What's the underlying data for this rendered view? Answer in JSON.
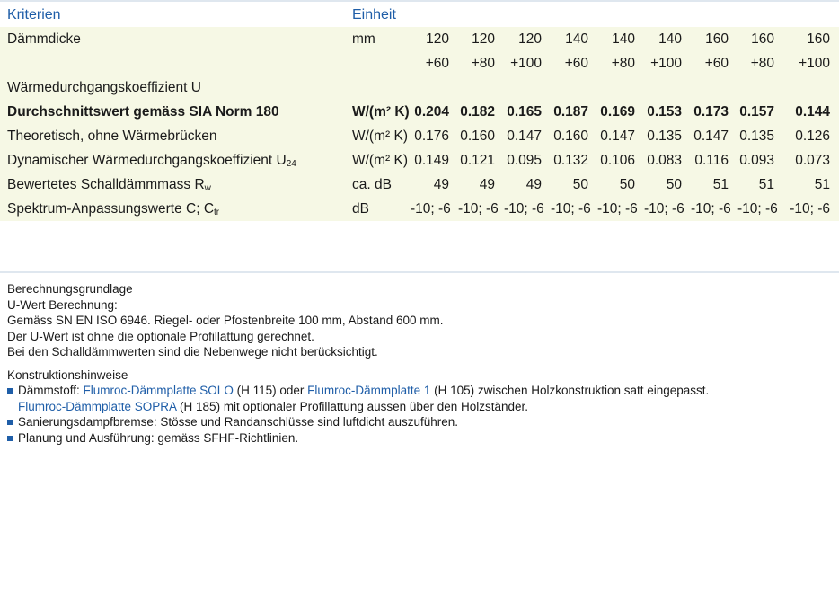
{
  "header": {
    "criteria": "Kriterien",
    "unit": "Einheit"
  },
  "rows": {
    "thickness": {
      "label": "Dämmdicke",
      "unit": "mm",
      "line1": [
        "120",
        "120",
        "120",
        "140",
        "140",
        "140",
        "160",
        "160",
        "160"
      ],
      "line2": [
        "+60",
        "+80",
        "+100",
        "+60",
        "+80",
        "+100",
        "+60",
        "+80",
        "+100"
      ]
    },
    "u_heading": "Wärmedurchgangskoeffizient U",
    "avg": {
      "label": "Durchschnittswert gemäss SIA Norm 180",
      "unit": "W/(m² K)",
      "values": [
        "0.204",
        "0.182",
        "0.165",
        "0.187",
        "0.169",
        "0.153",
        "0.173",
        "0.157",
        "0.144"
      ]
    },
    "theo": {
      "label": "Theoretisch, ohne Wärmebrücken",
      "unit": "W/(m² K)",
      "values": [
        "0.176",
        "0.160",
        "0.147",
        "0.160",
        "0.147",
        "0.135",
        "0.147",
        "0.135",
        "0.126"
      ]
    },
    "dyn": {
      "label": "Dynamischer Wärmedurchgangskoeffizient U",
      "sub": "24",
      "unit": "W/(m² K)",
      "values": [
        "0.149",
        "0.121",
        "0.095",
        "0.132",
        "0.106",
        "0.083",
        "0.116",
        "0.093",
        "0.073"
      ]
    },
    "sound": {
      "label": "Bewertetes Schalldämmmass R",
      "sub": "w",
      "unit": "ca. dB",
      "values": [
        "49",
        "49",
        "49",
        "50",
        "50",
        "50",
        "51",
        "51",
        "51"
      ]
    },
    "spectrum": {
      "label": "Spektrum-Anpassungswerte C; C",
      "sub": "tr",
      "unit": "dB",
      "values": [
        "-10; -6",
        "-10; -6",
        "-10; -6",
        "-10; -6",
        "-10; -6",
        "-10; -6",
        "-10; -6",
        "-10; -6",
        "-10; -6"
      ]
    }
  },
  "notes": {
    "calc_title": "Berechnungsgrundlage",
    "calc_lines": [
      "U-Wert Berechnung:",
      "Gemäss SN EN ISO 6946. Riegel- oder Pfostenbreite 100 mm, Abstand 600 mm.",
      "Der U-Wert ist ohne die optionale Profillattung gerechnet.",
      "Bei den Schalldämmwerten sind die Nebenwege nicht berücksichtigt."
    ],
    "hints_title": "Konstruktionshinweise",
    "hint1": {
      "a": "Dämmstoff: ",
      "link1": "Flumroc-Dämmplatte SOLO",
      "b": " (H 115) oder ",
      "link2": "Flumroc-Dämmplatte 1",
      "c": " (H 105) zwischen Holzkonstruktion satt eingepasst.",
      "link3": "Flumroc-Dämmplatte SOPRA",
      "d": " (H 185) mit optionaler Profillattung aussen über den Holzständer."
    },
    "hint2": "Sanierungsdampfbremse: Stösse und Randanschlüsse sind luftdicht auszuführen.",
    "hint3": "Planung und Ausführung: gemäss SFHF-Richtlinien."
  },
  "colors": {
    "accent": "#1f5ea8",
    "band": "#f6f8e5",
    "rule": "#dfe7ef"
  }
}
